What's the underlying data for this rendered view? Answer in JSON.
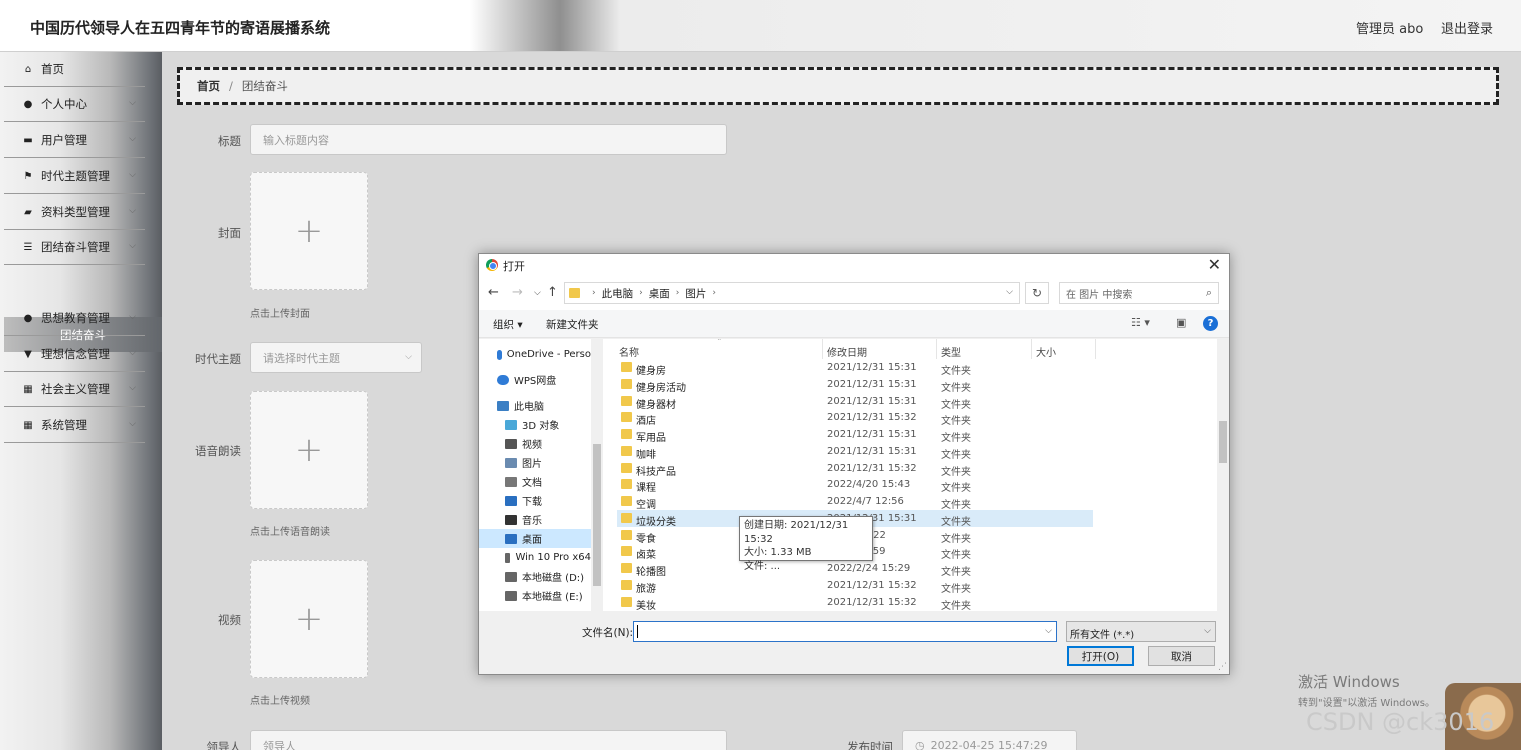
{
  "header": {
    "title": "中国历代领导人在五四青年节的寄语展播系统",
    "user": "管理员 abo",
    "logout": "退出登录"
  },
  "sidebar": {
    "items": [
      {
        "label": "首页",
        "icon": "home-icon",
        "glyph": "⌂",
        "caret": false
      },
      {
        "label": "个人中心",
        "icon": "user-icon",
        "glyph": "●",
        "caret": true
      },
      {
        "label": "用户管理",
        "icon": "id-card-icon",
        "glyph": "▬",
        "caret": true
      },
      {
        "label": "时代主题管理",
        "icon": "flag-icon",
        "glyph": "⚑",
        "caret": true
      },
      {
        "label": "资料类型管理",
        "icon": "briefcase-icon",
        "glyph": "▰",
        "caret": true
      },
      {
        "label": "团结奋斗管理",
        "icon": "list-icon",
        "glyph": "☰",
        "caret": true
      },
      {
        "label": "思想教育管理",
        "icon": "user-icon",
        "glyph": "●",
        "caret": true
      },
      {
        "label": "理想信念管理",
        "icon": "trophy-icon",
        "glyph": "▼",
        "caret": true
      },
      {
        "label": "社会主义管理",
        "icon": "grid-icon",
        "glyph": "▦",
        "caret": true
      },
      {
        "label": "系统管理",
        "icon": "grid-icon",
        "glyph": "▦",
        "caret": true
      }
    ],
    "active_sub": "团结奋斗"
  },
  "breadcrumb": {
    "home": "首页",
    "sep": "/",
    "current": "团结奋斗"
  },
  "form": {
    "title_label": "标题",
    "title_placeholder": "输入标题内容",
    "cover_label": "封面",
    "cover_hint": "点击上传封面",
    "era_label": "时代主题",
    "era_placeholder": "请选择时代主题",
    "audio_label": "语音朗读",
    "audio_hint": "点击上传语音朗读",
    "video_label": "视频",
    "video_hint": "点击上传视频",
    "leader_label": "领导人",
    "leader_placeholder": "领导人",
    "publish_label": "发布时间",
    "publish_value": "2022-04-25 15:47:29",
    "plus": "+"
  },
  "dialog": {
    "title": "打开",
    "close": "✕",
    "path": [
      "此电脑",
      "桌面",
      "图片"
    ],
    "search_placeholder": "在 图片 中搜索",
    "toolbar": {
      "organize": "组织 ▾",
      "new_folder": "新建文件夹"
    },
    "nav_pane": [
      {
        "label": "OneDrive - Perso",
        "icon": "cloud-icon"
      },
      {
        "label": "WPS网盘",
        "icon": "cloud-icon"
      },
      {
        "label": "此电脑",
        "icon": "computer-icon"
      },
      {
        "label": "3D 对象",
        "icon": "cube-icon"
      },
      {
        "label": "视频",
        "icon": "video-folder-icon"
      },
      {
        "label": "图片",
        "icon": "picture-folder-icon"
      },
      {
        "label": "文档",
        "icon": "document-folder-icon"
      },
      {
        "label": "下载",
        "icon": "download-icon"
      },
      {
        "label": "音乐",
        "icon": "music-icon"
      },
      {
        "label": "桌面",
        "icon": "desktop-icon"
      },
      {
        "label": "Win 10 Pro x64",
        "icon": "drive-icon"
      },
      {
        "label": "本地磁盘 (D:)",
        "icon": "drive-icon"
      },
      {
        "label": "本地磁盘 (E:)",
        "icon": "drive-icon"
      }
    ],
    "columns": {
      "name": "名称",
      "date": "修改日期",
      "type": "类型",
      "size": "大小"
    },
    "files": [
      {
        "name": "健身房",
        "date": "2021/12/31 15:31",
        "type": "文件夹"
      },
      {
        "name": "健身房活动",
        "date": "2021/12/31 15:31",
        "type": "文件夹"
      },
      {
        "name": "健身器材",
        "date": "2021/12/31 15:31",
        "type": "文件夹"
      },
      {
        "name": "酒店",
        "date": "2021/12/31 15:32",
        "type": "文件夹"
      },
      {
        "name": "军用品",
        "date": "2021/12/31 15:31",
        "type": "文件夹"
      },
      {
        "name": "咖啡",
        "date": "2021/12/31 15:31",
        "type": "文件夹"
      },
      {
        "name": "科技产品",
        "date": "2021/12/31 15:32",
        "type": "文件夹"
      },
      {
        "name": "课程",
        "date": "2022/4/20 15:43",
        "type": "文件夹"
      },
      {
        "name": "空调",
        "date": "2022/4/7 12:56",
        "type": "文件夹"
      },
      {
        "name": "垃圾分类",
        "date": "2021/12/31 15:31",
        "type": "文件夹"
      },
      {
        "name": "零食",
        "date": "11:22",
        "type": "文件夹"
      },
      {
        "name": "卤菜",
        "date": "3:59",
        "type": "文件夹"
      },
      {
        "name": "轮播图",
        "date": "2022/2/24 15:29",
        "type": "文件夹"
      },
      {
        "name": "旅游",
        "date": "2021/12/31 15:32",
        "type": "文件夹"
      },
      {
        "name": "美妆",
        "date": "2021/12/31 15:32",
        "type": "文件夹"
      }
    ],
    "tooltip": {
      "created": "创建日期: 2021/12/31 15:32",
      "size": "大小: 1.33 MB",
      "files": "文件: ..."
    },
    "filename_label": "文件名(N):",
    "filetype": "所有文件 (*.*)",
    "open_button": "打开(O)",
    "cancel_button": "取消"
  },
  "watermarks": {
    "activate_title": "激活 Windows",
    "activate_sub": "转到\"设置\"以激活 Windows。",
    "csdn": "CSDN @ck3016"
  }
}
